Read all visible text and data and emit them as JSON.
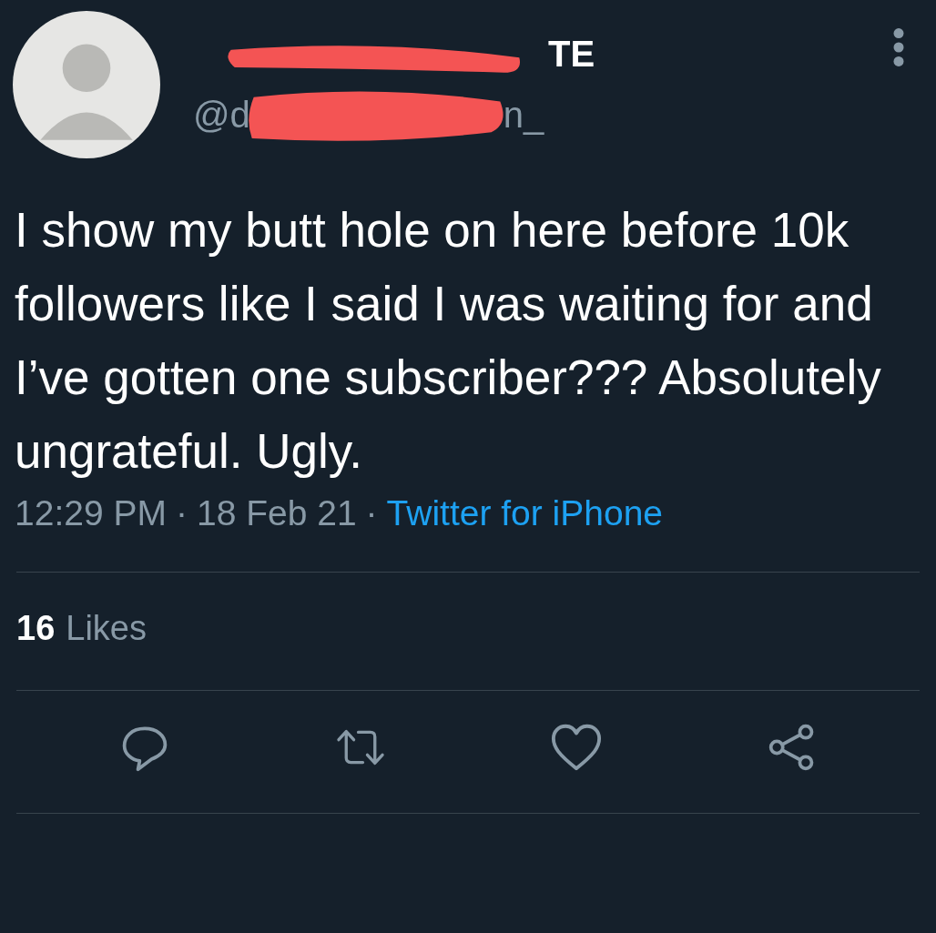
{
  "author": {
    "name_visible": "TE",
    "handle_start": "@d",
    "handle_end": "n_"
  },
  "tweet": {
    "text": "I show my butt hole on here before 10k followers like I said I was waiting for and I’ve gotten one subscriber??? Absolutely ungrateful. Ugly.",
    "meta": [
      {
        "kind": "time",
        "text": "12:29 PM"
      },
      {
        "kind": "separator",
        "text": "·"
      },
      {
        "kind": "date",
        "text": "18 Feb 21"
      },
      {
        "kind": "separator",
        "text": "·"
      },
      {
        "kind": "source",
        "text": "Twitter for iPhone"
      }
    ]
  },
  "stats": {
    "likes_count": "16",
    "likes_label": "Likes"
  }
}
